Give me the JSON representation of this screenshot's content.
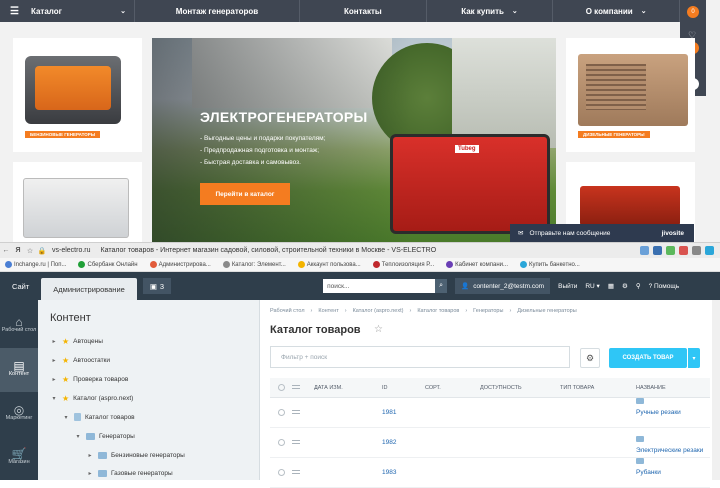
{
  "site": {
    "nav": [
      {
        "label": "Каталог"
      },
      {
        "label": "Монтаж генераторов"
      },
      {
        "label": "Контакты"
      },
      {
        "label": "Как купить"
      },
      {
        "label": "О компании"
      }
    ],
    "side_counts": [
      "0",
      "0",
      "0"
    ],
    "products": {
      "gasoline_badge": "БЕНЗИНОВЫЕ ГЕНЕРАТОРЫ",
      "diesel_badge": "ДИЗЕЛЬНЫЕ ГЕНЕРАТОРЫ"
    },
    "hero": {
      "title": "ЭЛЕКТРОГЕНЕРАТОРЫ",
      "bullets": [
        "Выгодные цены и подарки покупателям;",
        "Предпродажная подготовка и монтаж;",
        "Быстрая доставка и самовывоз."
      ],
      "cta": "Перейти в каталог",
      "brand": "Tubeg"
    },
    "chat": {
      "label": "Отправьте нам сообщение",
      "brand": "jivosite"
    }
  },
  "browser": {
    "url": "vs-electro.ru",
    "title": "Каталог товаров - Интернет магазин садовой, силовой, строительной техники в Москве - VS-ELECTRO",
    "bookmarks": [
      {
        "label": "Inchange.ru | Поп...",
        "color": "#4a7fd4"
      },
      {
        "label": "Сбербанк Онлайн",
        "color": "#21a038"
      },
      {
        "label": "Администрирова...",
        "color": "#e25b3a"
      },
      {
        "label": "Каталог: Элемент...",
        "color": "#8a8a8a"
      },
      {
        "label": "Аккаунт пользова...",
        "color": "#f4b400"
      },
      {
        "label": "Теплоизоляция Р...",
        "color": "#c0282d"
      },
      {
        "label": "Кабинет компани...",
        "color": "#6a3fb5"
      },
      {
        "label": "Купить банкетно...",
        "color": "#2aa6d9"
      }
    ]
  },
  "admin": {
    "tabs": {
      "site": "Сайт",
      "admin": "Администрирование"
    },
    "counter": "3",
    "search_placeholder": "поиск...",
    "user": "contenter_2@testm.com",
    "logout": "Выйти",
    "lang": "RU",
    "help": "Помощь",
    "rail": [
      {
        "icon": "home-icon",
        "label": "Рабочий стол"
      },
      {
        "icon": "content-icon",
        "label": "Контент"
      },
      {
        "icon": "marketing-icon",
        "label": "Маркетинг"
      },
      {
        "icon": "shop-icon",
        "label": "Магазин"
      }
    ],
    "tree_title": "Контент",
    "tree": [
      {
        "label": "Автоцены",
        "icon": "star",
        "toggle": "▸"
      },
      {
        "label": "Автоостатки",
        "icon": "star",
        "toggle": "▸"
      },
      {
        "label": "Проверка товаров",
        "icon": "star",
        "toggle": "▸"
      },
      {
        "label": "Каталог (aspro.next)",
        "icon": "star",
        "toggle": "▾"
      },
      {
        "label": "Каталог товаров",
        "icon": "doc",
        "toggle": "▾"
      },
      {
        "label": "Генераторы",
        "icon": "folder",
        "toggle": "▾"
      },
      {
        "label": "Бензиновые генераторы",
        "icon": "folder",
        "toggle": "▸"
      },
      {
        "label": "Газовые генераторы",
        "icon": "folder",
        "toggle": "▸"
      }
    ],
    "breadcrumbs": [
      "Рабочий стол",
      "Контент",
      "Каталог (aspro.next)",
      "Каталог товаров",
      "Генераторы",
      "Дизельные генераторы"
    ],
    "page_title": "Каталог товаров",
    "filter_placeholder": "Фильтр + поиск",
    "create_button": "СОЗДАТЬ ТОВАР",
    "columns": [
      "ДАТА ИЗМ.",
      "ID",
      "СОРТ.",
      "ДОСТУПНОСТЬ",
      "ТИП ТОВАРА",
      "НАЗВАНИЕ"
    ],
    "rows": [
      {
        "id": "1981",
        "name": "Ручные резаки"
      },
      {
        "id": "1982",
        "name": "Электрические резаки"
      },
      {
        "id": "1983",
        "name": "Рубанки"
      }
    ]
  }
}
